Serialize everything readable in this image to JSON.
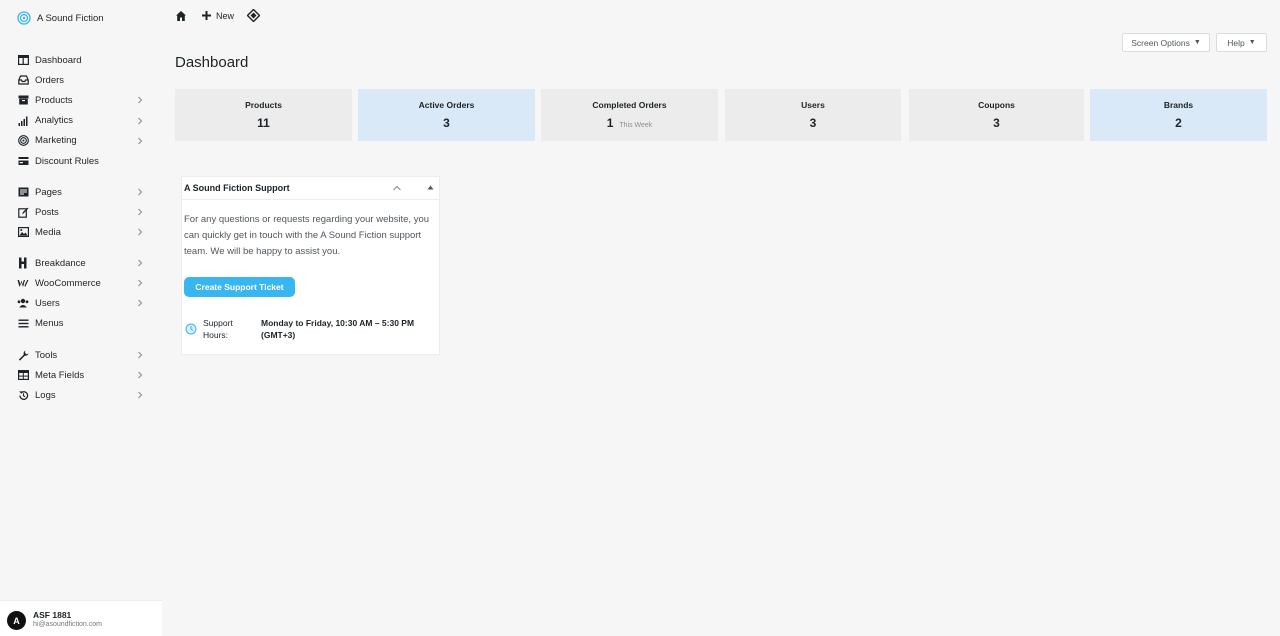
{
  "brand": {
    "name": "A Sound Fiction"
  },
  "topbar": {
    "new_label": "New"
  },
  "screen_options": {
    "label": "Screen Options",
    "arrow": "▼"
  },
  "help": {
    "label": "Help",
    "arrow": "▼"
  },
  "page": {
    "title": "Dashboard"
  },
  "sidebar": {
    "groups": [
      [
        {
          "label": "Dashboard",
          "icon": "dashboard-icon",
          "has_submenu": false
        },
        {
          "label": "Orders",
          "icon": "inbox-icon",
          "has_submenu": false
        },
        {
          "label": "Products",
          "icon": "archive-icon",
          "has_submenu": true
        },
        {
          "label": "Analytics",
          "icon": "bar-chart-icon",
          "has_submenu": true
        },
        {
          "label": "Marketing",
          "icon": "target-icon",
          "has_submenu": true
        },
        {
          "label": "Discount Rules",
          "icon": "card-icon",
          "has_submenu": false
        }
      ],
      [
        {
          "label": "Pages",
          "icon": "pages-icon",
          "has_submenu": true
        },
        {
          "label": "Posts",
          "icon": "edit-icon",
          "has_submenu": true
        },
        {
          "label": "Media",
          "icon": "image-icon",
          "has_submenu": true
        }
      ],
      [
        {
          "label": "Breakdance",
          "icon": "breakdance-icon",
          "has_submenu": true
        },
        {
          "label": "WooCommerce",
          "icon": "woo-icon",
          "has_submenu": true
        },
        {
          "label": "Users",
          "icon": "users-icon",
          "has_submenu": true
        },
        {
          "label": "Menus",
          "icon": "menu-icon",
          "has_submenu": false
        }
      ],
      [
        {
          "label": "Tools",
          "icon": "wrench-icon",
          "has_submenu": true
        },
        {
          "label": "Meta Fields",
          "icon": "table-icon",
          "has_submenu": true
        },
        {
          "label": "Logs",
          "icon": "history-icon",
          "has_submenu": true
        }
      ]
    ]
  },
  "stats": [
    {
      "label": "Products",
      "value": "11",
      "note": "",
      "highlight": false
    },
    {
      "label": "Active Orders",
      "value": "3",
      "note": "",
      "highlight": true
    },
    {
      "label": "Completed Orders",
      "value": "1",
      "note": "This Week",
      "highlight": false
    },
    {
      "label": "Users",
      "value": "3",
      "note": "",
      "highlight": false
    },
    {
      "label": "Coupons",
      "value": "3",
      "note": "",
      "highlight": false
    },
    {
      "label": "Brands",
      "value": "2",
      "note": "",
      "highlight": true
    }
  ],
  "support": {
    "title": "A Sound Fiction Support",
    "text": "For any questions or requests regarding your website, you can quickly get in touch with the A Sound Fiction support team. We will be happy to assist you.",
    "button": "Create Support Ticket",
    "hours_label": "Support Hours:",
    "hours_value": "Monday to Friday, 10:30 AM – 5:30 PM (GMT+3)"
  },
  "user": {
    "initial": "A",
    "name": "ASF 1881",
    "email": "hi@asoundfiction.com"
  },
  "colors": {
    "accent": "#38b6f0",
    "highlight_card": "#d9e9f7",
    "card": "#ececec"
  }
}
